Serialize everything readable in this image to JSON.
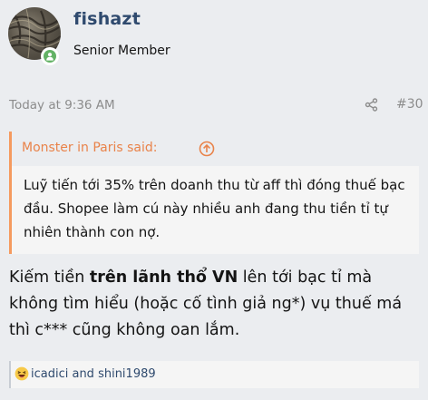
{
  "user": {
    "name": "fishazt",
    "title": "Senior Member",
    "online": true
  },
  "post": {
    "time": "Today at 9:36 AM",
    "number": "#30"
  },
  "quote": {
    "author": "Monster in Paris said:",
    "text": "Luỹ tiến tới 35% trên doanh thu từ aff thì đóng thuế bạc đầu. Shopee làm cú này nhiều anh đang thu tiền tỉ tự nhiên thành con nợ."
  },
  "message": {
    "before": "Kiếm tiền ",
    "bold": "trên lãnh thổ VN",
    "after": " lên tới bạc tỉ mà không tìm hiểu (hoặc cố tình giả ng*) vụ thuế má thì c*** cũng không oan lắm."
  },
  "reactions": {
    "icon": "haha-reaction-icon",
    "users": "icadici and shini1989"
  },
  "colors": {
    "username": "#2f4a6e",
    "quote_accent": "#f59a5e",
    "quote_author": "#e9834a",
    "online": "#63b265",
    "meta": "#8c8c8c"
  }
}
